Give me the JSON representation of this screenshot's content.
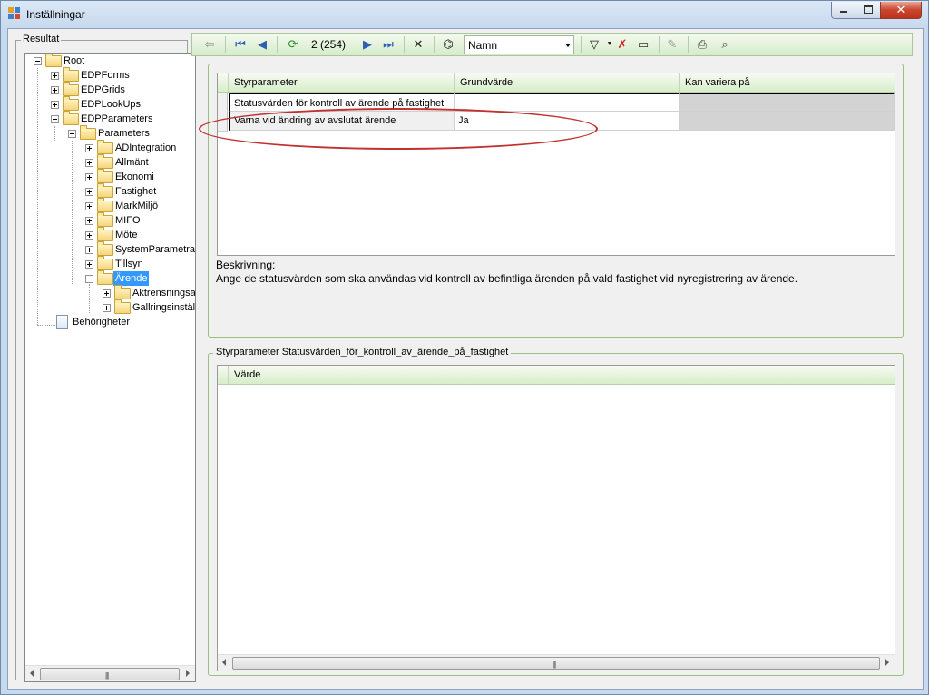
{
  "window": {
    "title": "Inställningar"
  },
  "left_panel": {
    "group_label": "Resultat",
    "tree": [
      {
        "label": "Root"
      },
      {
        "label": "EDPForms"
      },
      {
        "label": "EDPGrids"
      },
      {
        "label": "EDPLookUps"
      },
      {
        "label": "EDPParameters"
      },
      {
        "label": "Parameters"
      },
      {
        "label": "ADIntegration"
      },
      {
        "label": "Allmänt"
      },
      {
        "label": "Ekonomi"
      },
      {
        "label": "Fastighet"
      },
      {
        "label": "MarkMiljö"
      },
      {
        "label": "MIFO"
      },
      {
        "label": "Möte"
      },
      {
        "label": "SystemParametrar"
      },
      {
        "label": "Tillsyn"
      },
      {
        "label": "Ärende"
      },
      {
        "label": "Aktrensningsalt"
      },
      {
        "label": "Gallringsinställn"
      },
      {
        "label": "Behörigheter"
      }
    ]
  },
  "toolbar": {
    "page_info": "2 (254)",
    "search_field": "Namn",
    "icons": [
      "back-icon",
      "first-icon",
      "prev-icon",
      "refresh-icon",
      "next-icon",
      "last-icon",
      "delete-icon",
      "binoculars-icon",
      "filter-icon",
      "clear-filter-icon",
      "export-icon",
      "edit-icon",
      "print-icon",
      "print-preview-icon"
    ]
  },
  "params_grid": {
    "columns": [
      "Styrparameter",
      "Grundvärde",
      "Kan variera på"
    ],
    "rows": [
      {
        "name": "Statusvärden för kontroll av ärende på fastighet",
        "value": "",
        "variera": ""
      },
      {
        "name": "Varna vid ändring av avslutat ärende",
        "value": "Ja",
        "variera": ""
      }
    ]
  },
  "description": {
    "label": "Beskrivning:",
    "text": "Ange de statusvärden som ska användas vid kontroll av befintliga ärenden på vald fastighet vid nyregistrering av ärende."
  },
  "values_panel": {
    "group_label": "Styrparameter Statusvärden_för_kontroll_av_ärende_på_fastighet",
    "columns": [
      "Värde"
    ]
  },
  "colors": {
    "highlight": "#c0312f",
    "selection": "#3399ff",
    "toolbar": "#d5ecc8"
  }
}
